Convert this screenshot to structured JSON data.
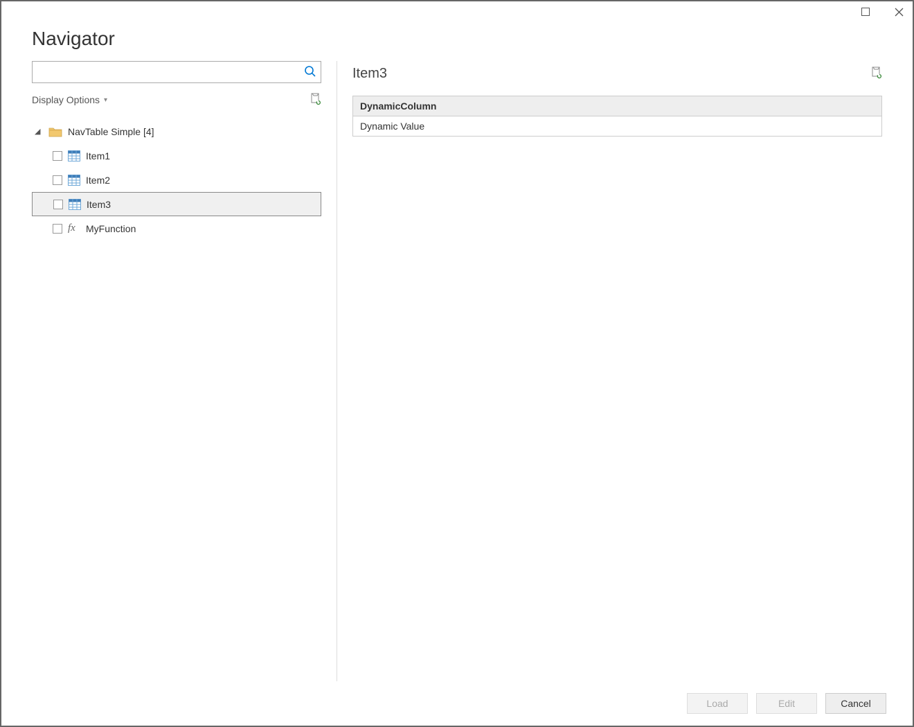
{
  "window": {
    "title": "Navigator"
  },
  "search": {
    "value": "",
    "placeholder": ""
  },
  "display_options_label": "Display Options",
  "tree": {
    "root": {
      "label": "NavTable Simple [4]"
    },
    "items": [
      {
        "label": "Item1",
        "type": "table"
      },
      {
        "label": "Item2",
        "type": "table"
      },
      {
        "label": "Item3",
        "type": "table"
      },
      {
        "label": "MyFunction",
        "type": "function"
      }
    ]
  },
  "preview": {
    "title": "Item3",
    "columns": [
      "DynamicColumn"
    ],
    "rows": [
      [
        "Dynamic Value"
      ]
    ]
  },
  "footer": {
    "load": "Load",
    "edit": "Edit",
    "cancel": "Cancel"
  }
}
